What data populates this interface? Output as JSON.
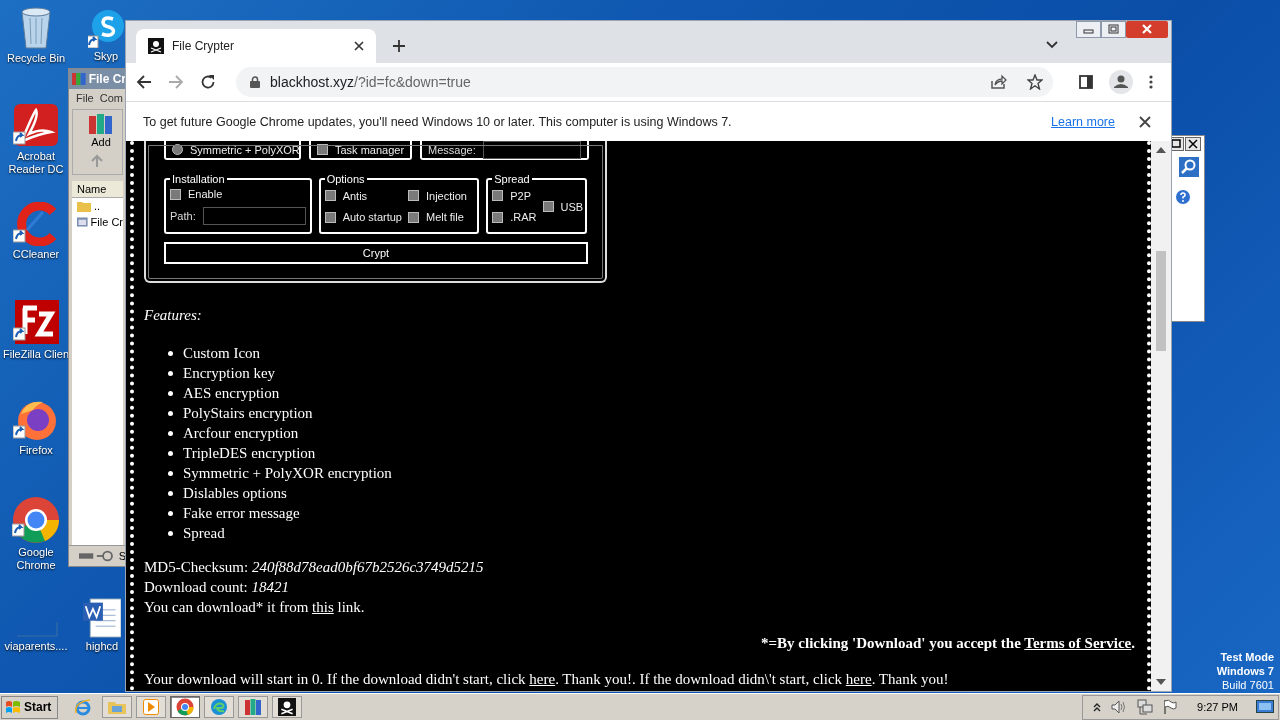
{
  "desktop": {
    "icons": [
      {
        "label": "Recycle Bin",
        "kind": "recycle"
      },
      {
        "label": "Skyp",
        "kind": "skype"
      },
      {
        "label": "Acrobat Reader DC",
        "kind": "acrobat"
      },
      {
        "label": "CCleaner",
        "kind": "ccleaner"
      },
      {
        "label": "FileZilla Clien",
        "kind": "filezilla"
      },
      {
        "label": "Firefox",
        "kind": "firefox"
      },
      {
        "label": "Google Chrome",
        "kind": "chrome"
      },
      {
        "label": "viaparents....",
        "kind": "blank"
      },
      {
        "label": "highcd",
        "kind": "word"
      }
    ],
    "system_notice": [
      "Test Mode",
      "Windows 7",
      "Build 7601"
    ]
  },
  "archive_window": {
    "title": "File Cr",
    "menu": [
      "File",
      "Com"
    ],
    "toolbar_button": "Add",
    "column": "Name",
    "rows": [
      "..",
      "File Cr"
    ],
    "status": "S"
  },
  "browser": {
    "tabs": [
      {
        "title": "File Crypter",
        "selected": true
      }
    ],
    "url": {
      "host": "blackhost.xyz",
      "path": "/?id=fc&down=true"
    },
    "infobar": {
      "message": "To get future Google Chrome updates, you'll need Windows 10 or later. This computer is using Windows 7.",
      "link": "Learn more"
    },
    "page": {
      "dialog": {
        "top_row": [
          {
            "kind": "radio",
            "label": "Symmetric + PolyXOR",
            "checked": false
          },
          {
            "kind": "checkbox",
            "label": "Task manager",
            "checked": false
          },
          {
            "kind": "field",
            "label": "Message:"
          }
        ],
        "groups": [
          {
            "title": "Installation",
            "columns": [
              [
                {
                  "kind": "checkbox",
                  "label": "Enable",
                  "checked": false
                },
                {
                  "kind": "field",
                  "label": "Path:"
                }
              ]
            ]
          },
          {
            "title": "Options",
            "columns": [
              [
                {
                  "kind": "checkbox",
                  "label": "Antis",
                  "checked": false
                },
                {
                  "kind": "checkbox",
                  "label": "Auto startup",
                  "checked": false
                }
              ],
              [
                {
                  "kind": "checkbox",
                  "label": "Injection",
                  "checked": false
                },
                {
                  "kind": "checkbox",
                  "label": "Melt file",
                  "checked": false
                }
              ]
            ]
          },
          {
            "title": "Spread",
            "columns": [
              [
                {
                  "kind": "checkbox",
                  "label": "P2P",
                  "checked": false
                },
                {
                  "kind": "checkbox",
                  "label": ".RAR",
                  "checked": false
                }
              ],
              [
                {
                  "kind": "checkbox",
                  "label": "USB",
                  "checked": false
                }
              ]
            ]
          }
        ],
        "button": "Crypt"
      },
      "features_title": "Features:",
      "features": [
        "Custom Icon",
        "Encryption key",
        "AES encryption",
        "PolyStairs encryption",
        "Arcfour encryption",
        "TripleDES encryption",
        "Symmetric + PolyXOR encryption",
        "Dislables options",
        "Fake error message",
        "Spread"
      ],
      "info": [
        {
          "label": "MD5-Checksum:",
          "value": "240f88d78ead0bf67b2526c3749d5215"
        },
        {
          "label": "Download count:",
          "value": "18421"
        }
      ],
      "download_line": [
        {
          "text": "You can download* it from ",
          "link": false
        },
        {
          "text": "this",
          "link": true
        },
        {
          "text": " link.",
          "link": false
        }
      ],
      "terms_line": [
        {
          "text": "*=By clicking 'Download' you accept the ",
          "link": false
        },
        {
          "text": "Terms of Service",
          "link": true
        },
        {
          "text": ".",
          "link": false
        }
      ],
      "notice_line": [
        {
          "text": "Your download will start in 0. If the download didn't start, click ",
          "link": false
        },
        {
          "text": "here",
          "link": true
        },
        {
          "text": ". Thank you!. If the download didn\\'t start, click ",
          "link": false
        },
        {
          "text": "here",
          "link": true
        },
        {
          "text": ". Thank you!",
          "link": false
        }
      ]
    }
  },
  "taskbar": {
    "start": "Start",
    "apps": [
      {
        "kind": "ie",
        "selected": false
      },
      {
        "kind": "explorer",
        "selected": false
      },
      {
        "kind": "media",
        "selected": false
      },
      {
        "kind": "chrome",
        "selected": true
      },
      {
        "kind": "edge",
        "selected": false
      },
      {
        "kind": "archiver",
        "selected": false
      },
      {
        "kind": "pirate",
        "selected": false
      }
    ],
    "clock": "9:27 PM"
  }
}
